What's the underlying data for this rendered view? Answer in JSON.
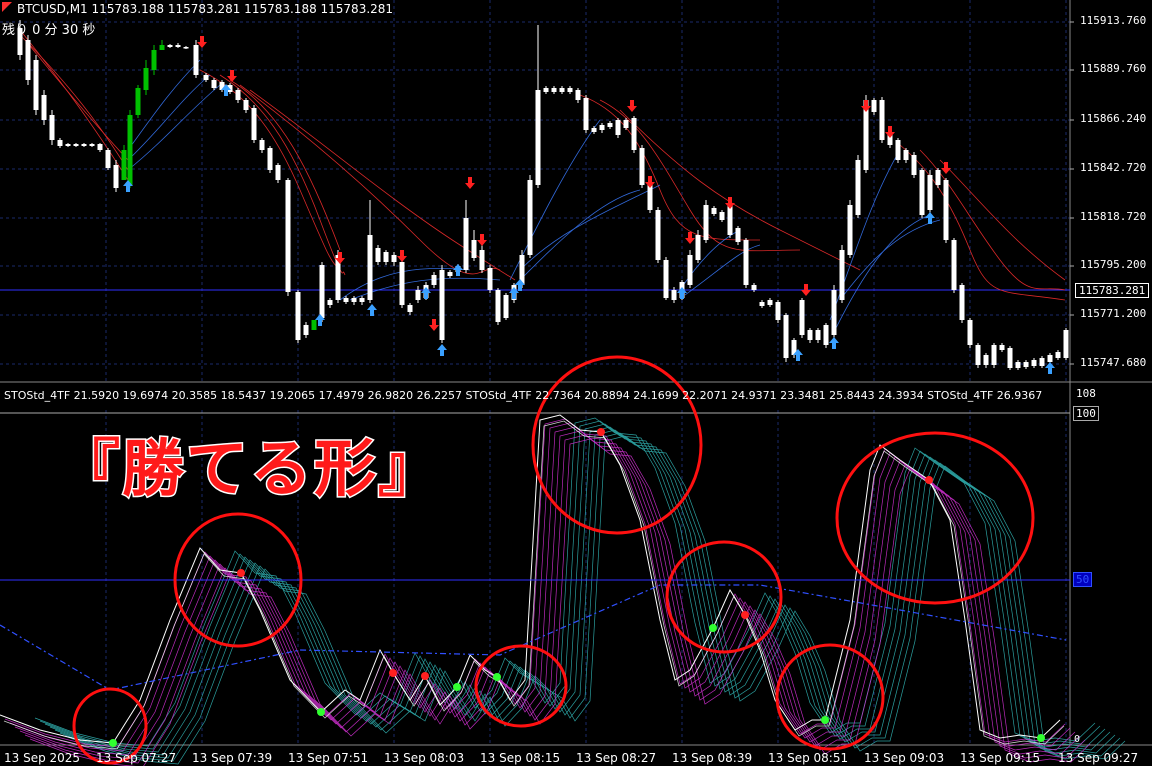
{
  "header": {
    "symbol_line": "BTCUSD,M1  115783.188 115783.281 115783.188 115783.281",
    "countdown": "残り 0 分 30 秒"
  },
  "price_axis": {
    "ticks": [
      "115913.760",
      "115889.760",
      "115866.240",
      "115842.720",
      "115818.720",
      "115795.200",
      "115771.200",
      "115747.680"
    ],
    "current_price": "115783.281"
  },
  "indicator": {
    "label_line": "STOStd_4TF 21.5920 19.6974 20.3585 18.5437 19.2065 17.4979 26.9820 26.2257   STOStd_4TF 22.7364 20.8894 24.1699 22.2071 24.9371 23.3481 25.8443 24.3934   STOStd_4TF 26.9367",
    "scale_top": "108",
    "level_100": "100",
    "level_50": "50",
    "level_0": "0"
  },
  "annotation": {
    "headline": "『勝てる形』"
  },
  "time_axis": {
    "ticks": [
      "13 Sep 2025",
      "13 Sep 07:27",
      "13 Sep 07:39",
      "13 Sep 07:51",
      "13 Sep 08:03",
      "13 Sep 08:15",
      "13 Sep 08:27",
      "13 Sep 08:39",
      "13 Sep 08:51",
      "13 Sep 09:03",
      "13 Sep 09:15",
      "13 Sep 09:27"
    ]
  },
  "colors": {
    "bull_candle": "#00c000",
    "bear_candle": "#ffffff",
    "ribbon_down": "#ff3030",
    "ribbon_up": "#3a7bff",
    "stoch_fast": "#ffffff",
    "stoch_magenta": "#d030d0",
    "stoch_cyan": "#30b0b0",
    "circle": "#ff1010",
    "grid": "#1a2a6a"
  }
}
